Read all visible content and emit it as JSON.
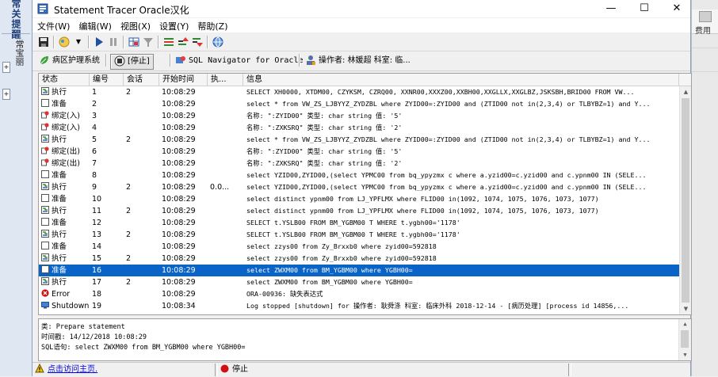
{
  "background": {
    "left_vertical_text": "常关提醒",
    "left_vertical_text2": "常宝丽",
    "right_label": "费用"
  },
  "window": {
    "title": "Statement Tracer Oracle汉化",
    "minimize": "—",
    "maximize": "☐",
    "close": "✕"
  },
  "menu": [
    "文件(W)",
    "编辑(W)",
    "视图(X)",
    "设置(Y)",
    "帮助(Z)"
  ],
  "toolbar2": {
    "item1": "病区护理系统",
    "stop": "[停止]",
    "navigator": "SQL Navigator for Oracle",
    "operator": "操作者: 林媛超  科室: 临..."
  },
  "grid": {
    "headers": [
      "状态",
      "编号",
      "会话",
      "开始时间",
      "执...",
      "信息"
    ],
    "rows": [
      {
        "status": "执行",
        "icon": "exec",
        "no": "1",
        "cursor": "2",
        "time": "10:08:29",
        "exec": "",
        "msg": "SELECT XH0000, XTDM00, CZYKSM, CZRQ00, XXNR00,XXXZ00,XXBH00,XXGLLX,XXGLBZ,JSKSBH,BRID00     FROM VW..."
      },
      {
        "status": "准备",
        "icon": "prep",
        "no": "2",
        "cursor": "",
        "time": "10:08:29",
        "exec": "",
        "msg": "select * from VW_ZS_LJBYYZ_ZYDZBL where ZYID00=:ZYID00 and (ZTID00 not in(2,3,4) or TLBYBZ=1) and Y..."
      },
      {
        "status": "绑定(入)",
        "icon": "bind",
        "no": "3",
        "cursor": "",
        "time": "10:08:29",
        "exec": "",
        "msg": "名称: \":ZYID00\" 类型: char string 值:   '5'"
      },
      {
        "status": "绑定(入)",
        "icon": "bind",
        "no": "4",
        "cursor": "",
        "time": "10:08:29",
        "exec": "",
        "msg": "名称: \":ZXKSRQ\" 类型: char string 值:   '2'"
      },
      {
        "status": "执行",
        "icon": "exec",
        "no": "5",
        "cursor": "2",
        "time": "10:08:29",
        "exec": "",
        "msg": "select * from VW_ZS_LJBYYZ_ZYDZBL where ZYID00=:ZYID00 and (ZTID00 not in(2,3,4) or TLBYBZ=1) and Y..."
      },
      {
        "status": "绑定(出)",
        "icon": "bind",
        "no": "6",
        "cursor": "",
        "time": "10:08:29",
        "exec": "",
        "msg": "名称: \":ZYID00\" 类型: char string 值:   '5'"
      },
      {
        "status": "绑定(出)",
        "icon": "bind",
        "no": "7",
        "cursor": "",
        "time": "10:08:29",
        "exec": "",
        "msg": "名称: \":ZXKSRQ\" 类型: char string 值:   '2'"
      },
      {
        "status": "准备",
        "icon": "prep",
        "no": "8",
        "cursor": "",
        "time": "10:08:29",
        "exec": "",
        "msg": " select YZID00,ZYID00,(select YPMC00 from bq_ypyzmx c where a.yzid00=c.yzid00 and c.ypnm00 IN (SELE..."
      },
      {
        "status": "执行",
        "icon": "exec",
        "no": "9",
        "cursor": "2",
        "time": "10:08:29",
        "exec": "0.0...",
        "msg": " select YZID00,ZYID00,(select YPMC00 from bq_ypyzmx c where a.yzid00=c.yzid00 and c.ypnm00 IN (SELE..."
      },
      {
        "status": "准备",
        "icon": "prep",
        "no": "10",
        "cursor": "",
        "time": "10:08:29",
        "exec": "",
        "msg": "select distinct ypnm00 from LJ_YPFLMX where FLID00 in(1092, 1074, 1075, 1076, 1073, 1077)"
      },
      {
        "status": "执行",
        "icon": "exec",
        "no": "11",
        "cursor": "2",
        "time": "10:08:29",
        "exec": "",
        "msg": "select distinct ypnm00 from LJ_YPFLMX where FLID00 in(1092, 1074, 1075, 1076, 1073, 1077)"
      },
      {
        "status": "准备",
        "icon": "prep",
        "no": "12",
        "cursor": "",
        "time": "10:08:29",
        "exec": "",
        "msg": " SELECT t.YSLB00 FROM BM_YGBM00 T WHERE t.ygbh00='1178'"
      },
      {
        "status": "执行",
        "icon": "exec",
        "no": "13",
        "cursor": "2",
        "time": "10:08:29",
        "exec": "",
        "msg": " SELECT t.YSLB00 FROM BM_YGBM00 T WHERE t.ygbh00='1178'"
      },
      {
        "status": "准备",
        "icon": "prep",
        "no": "14",
        "cursor": "",
        "time": "10:08:29",
        "exec": "",
        "msg": "select zzys00 from Zy_Brxxb0 where zyid00=592818"
      },
      {
        "status": "执行",
        "icon": "exec",
        "no": "15",
        "cursor": "2",
        "time": "10:08:29",
        "exec": "",
        "msg": "select zzys00 from Zy_Brxxb0 where zyid00=592818"
      },
      {
        "status": "准备",
        "icon": "prep",
        "no": "16",
        "cursor": "",
        "time": "10:08:29",
        "exec": "",
        "msg": "select ZWXM00 from BM_YGBM00 where YGBH00=",
        "selected": true
      },
      {
        "status": "执行",
        "icon": "exec",
        "no": "17",
        "cursor": "2",
        "time": "10:08:29",
        "exec": "",
        "msg": "select ZWXM00 from BM_YGBM00 where YGBH00="
      },
      {
        "status": "Error",
        "icon": "error",
        "no": "18",
        "cursor": "",
        "time": "10:08:29",
        "exec": "",
        "msg": "ORA-00936: 缺失表达式"
      },
      {
        "status": "Shutdown",
        "icon": "shutdown",
        "no": "19",
        "cursor": "",
        "time": "10:08:34",
        "exec": "",
        "msg": "Log stopped [shutdown] for  操作者: 耿舜涤  科室: 临床外科  2018-12-14 - [病历处理] [process id 14856,..."
      }
    ]
  },
  "detail": {
    "line1": "类: Prepare statement",
    "line2": "时间戳: 14/12/2018 10:08:29",
    "line3": "SQL语句: select ZWXM00 from BM_YGBM00 where YGBH00="
  },
  "status": {
    "link": "点击访问主页.",
    "stop": "停止"
  },
  "colors": {
    "selection": "#0a64c8",
    "error": "#d01010"
  }
}
